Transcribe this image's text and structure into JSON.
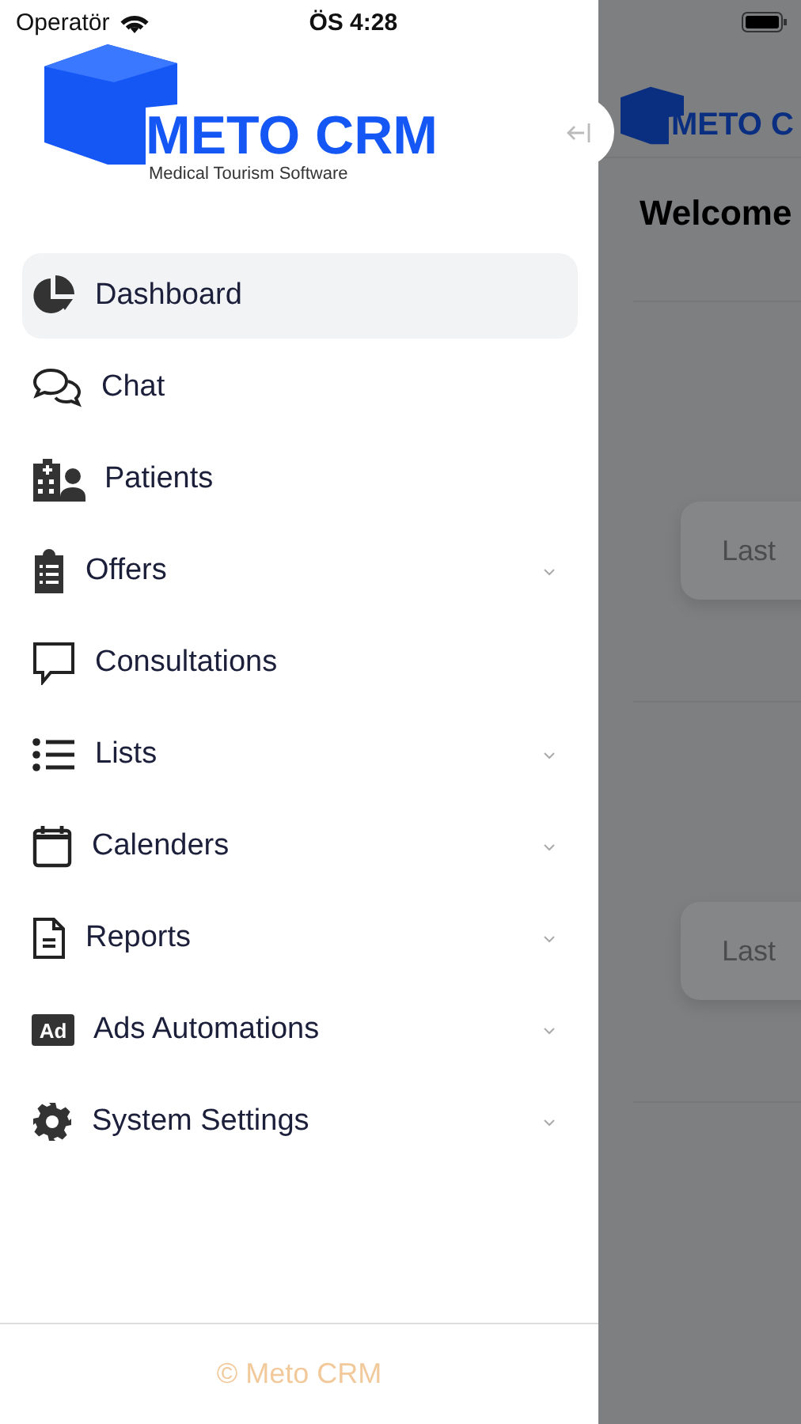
{
  "status_bar": {
    "carrier": "Operatör",
    "time": "ÖS 4:28"
  },
  "drawer": {
    "logo": {
      "title": "METO CRM",
      "subtitle": "Medical Tourism Software"
    },
    "menu": [
      {
        "label": "Dashboard",
        "kind": "pie",
        "selected": true,
        "has_submenu": false
      },
      {
        "label": "Chat",
        "kind": "chat",
        "selected": false,
        "has_submenu": false
      },
      {
        "label": "Patients",
        "kind": "patients",
        "selected": false,
        "has_submenu": false
      },
      {
        "label": "Offers",
        "kind": "clipboard",
        "selected": false,
        "has_submenu": true
      },
      {
        "label": "Consultations",
        "kind": "comment",
        "selected": false,
        "has_submenu": false
      },
      {
        "label": "Lists",
        "kind": "list",
        "selected": false,
        "has_submenu": true
      },
      {
        "label": "Calenders",
        "kind": "calendar",
        "selected": false,
        "has_submenu": true
      },
      {
        "label": "Reports",
        "kind": "document",
        "selected": false,
        "has_submenu": true
      },
      {
        "label": "Ads Automations",
        "kind": "ad",
        "icon_text": "Ad",
        "selected": false,
        "has_submenu": true
      },
      {
        "label": "System Settings",
        "kind": "gear",
        "selected": false,
        "has_submenu": true
      }
    ],
    "footer": "© Meto CRM"
  },
  "background_page": {
    "logo_title": "METO C",
    "heading": "Welcome",
    "cards": [
      {
        "label": "Last"
      },
      {
        "label": "Last"
      }
    ]
  }
}
